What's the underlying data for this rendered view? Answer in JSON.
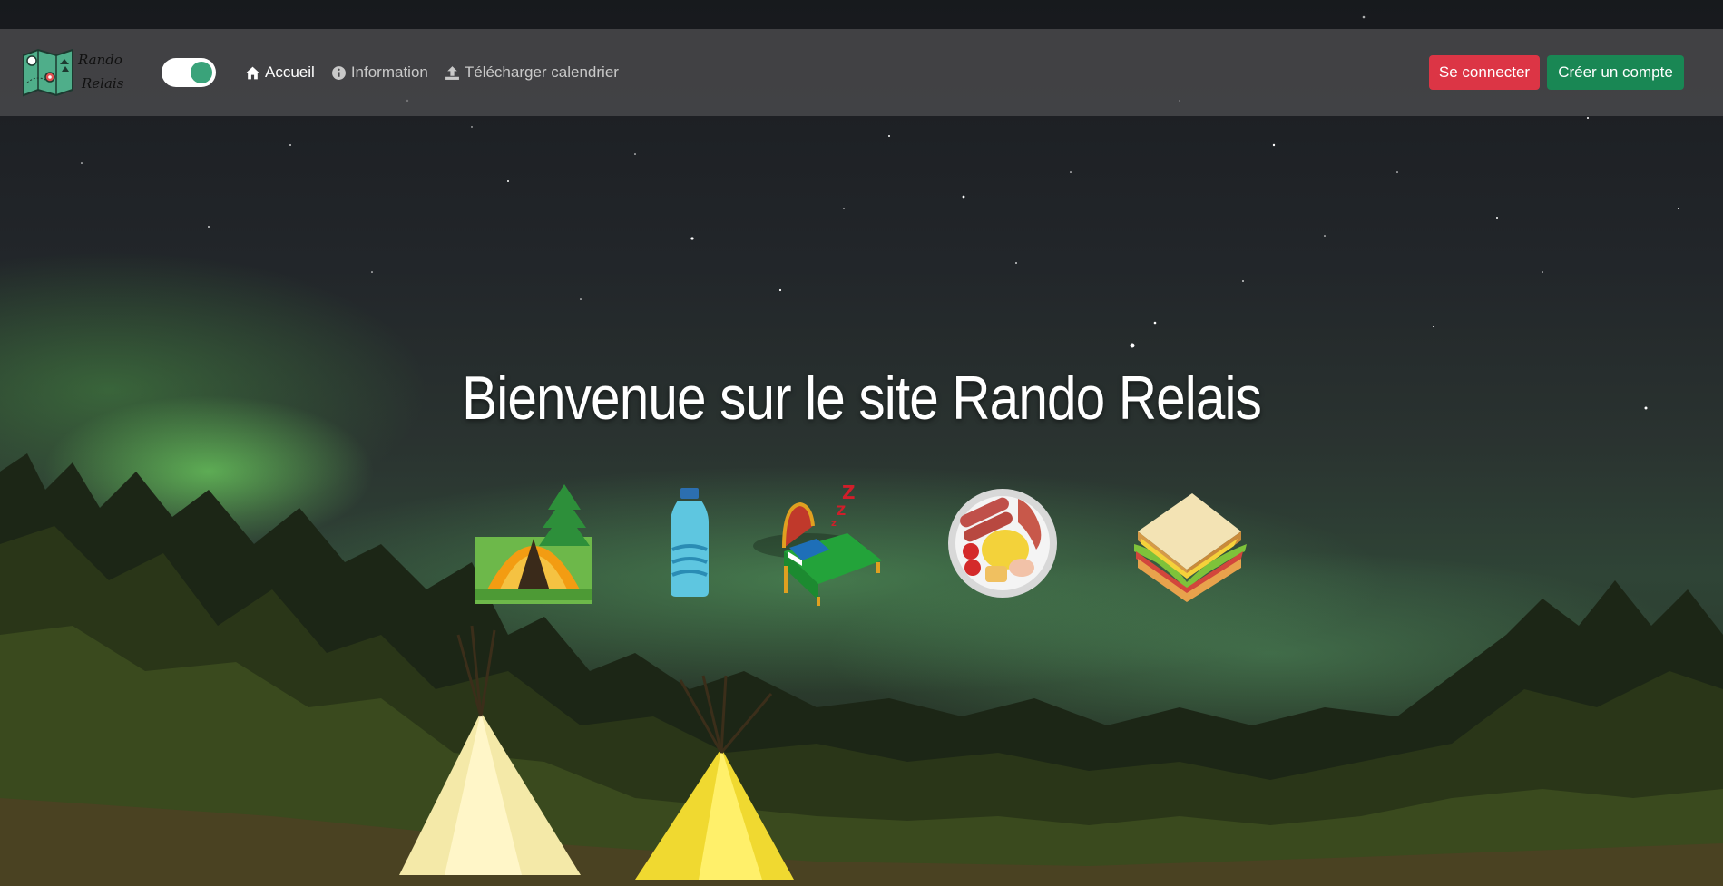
{
  "logo": {
    "line1": "Rando",
    "line2": "Relais"
  },
  "theme_toggle": {
    "state": "on"
  },
  "nav": {
    "items": [
      {
        "label": "Accueil",
        "icon": "home-icon",
        "active": true
      },
      {
        "label": "Information",
        "icon": "info-circle-icon",
        "active": false
      },
      {
        "label": "Télécharger calendrier",
        "icon": "upload-icon",
        "active": false
      }
    ]
  },
  "auth": {
    "login_label": "Se connecter",
    "signup_label": "Créer un compte"
  },
  "hero": {
    "title": "Bienvenue sur le site Rando Relais"
  },
  "features": [
    {
      "icon": "tent-icon"
    },
    {
      "icon": "water-bottle-icon"
    },
    {
      "icon": "bed-icon"
    },
    {
      "icon": "breakfast-plate-icon"
    },
    {
      "icon": "sandwich-icon"
    }
  ],
  "colors": {
    "login_button": "#dc3545",
    "signup_button": "#198754",
    "toggle_knob": "#3aa37a",
    "navbar": "#4b4b4e"
  }
}
